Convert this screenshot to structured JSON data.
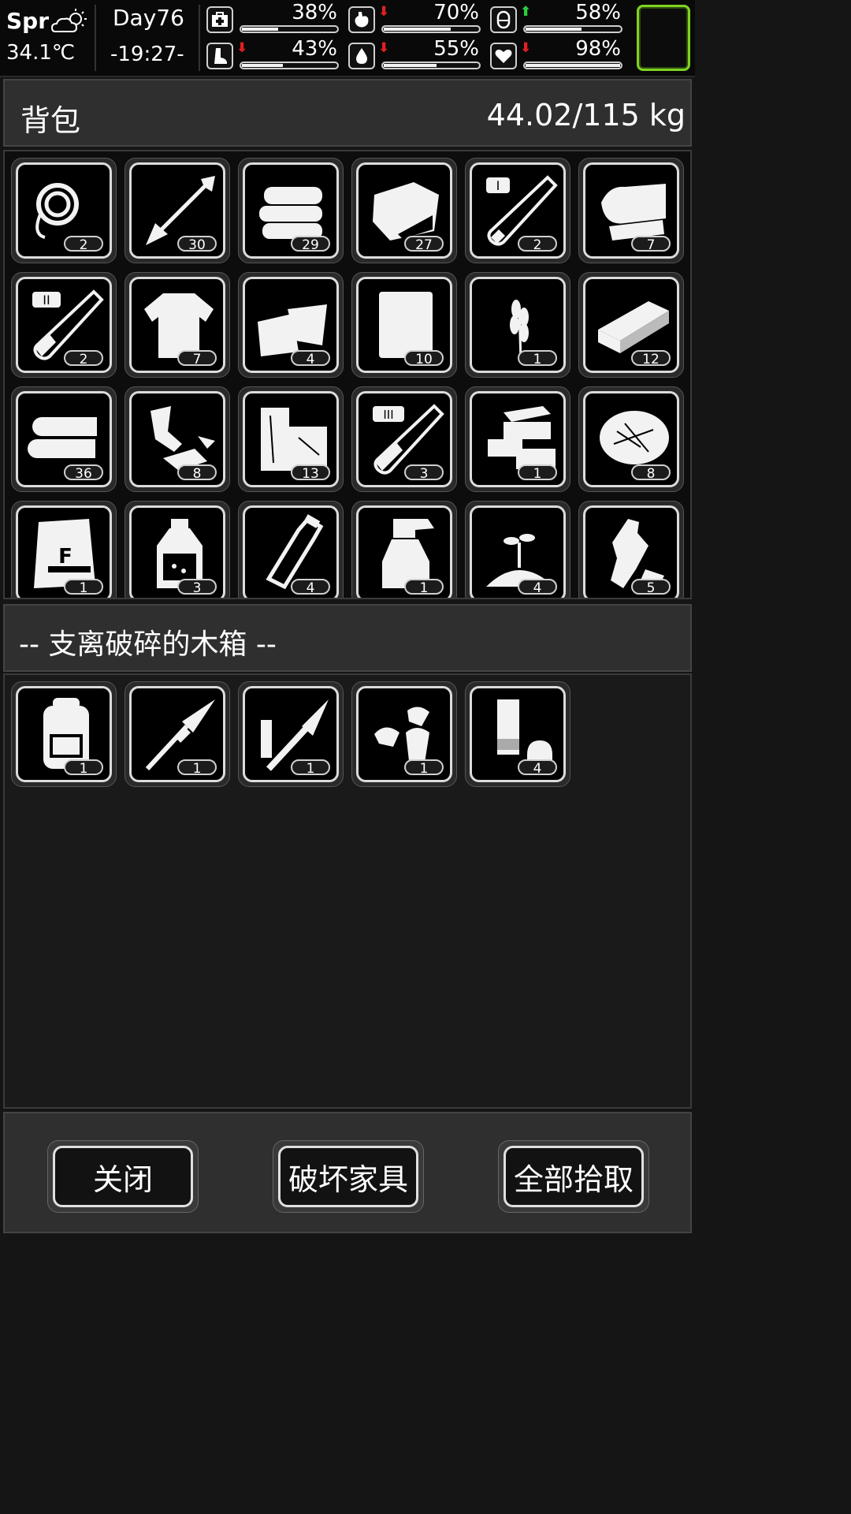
{
  "hud": {
    "season": "Spr",
    "temperature": "34.1℃",
    "day": "Day76",
    "time": "-19:27-",
    "preview_accent": "#7ed321",
    "stats": [
      {
        "icon": "medkit-icon",
        "value": "38%",
        "fraction": 0.38,
        "trend": "none"
      },
      {
        "icon": "stomach-icon",
        "value": "70%",
        "fraction": 0.7,
        "trend": "down"
      },
      {
        "icon": "energy-capsule-icon",
        "value": "58%",
        "fraction": 0.58,
        "trend": "up"
      },
      {
        "icon": "foot-icon",
        "value": "43%",
        "fraction": 0.43,
        "trend": "down"
      },
      {
        "icon": "water-drop-icon",
        "value": "55%",
        "fraction": 0.55,
        "trend": "down"
      },
      {
        "icon": "heart-icon",
        "value": "98%",
        "fraction": 0.98,
        "trend": "down"
      }
    ],
    "trend_colors": {
      "up": "#2ecc40",
      "down": "#e02020"
    }
  },
  "backpack": {
    "title": "背包",
    "weight": "44.02/115 kg",
    "items": [
      {
        "icon": "rope-icon",
        "qty": "2"
      },
      {
        "icon": "arrow-icon",
        "qty": "30"
      },
      {
        "icon": "cloth-stack-icon",
        "qty": "29"
      },
      {
        "icon": "raw-meat-icon",
        "qty": "27"
      },
      {
        "icon": "test-tube-1-icon",
        "qty": "2"
      },
      {
        "icon": "folded-cloth-icon",
        "qty": "7"
      },
      {
        "icon": "test-tube-2-icon",
        "qty": "2"
      },
      {
        "icon": "torn-shirt-icon",
        "qty": "7"
      },
      {
        "icon": "cloth-scraps-icon",
        "qty": "4"
      },
      {
        "icon": "paper-sheet-icon",
        "qty": "10"
      },
      {
        "icon": "wheat-icon",
        "qty": "1"
      },
      {
        "icon": "wood-plank-icon",
        "qty": "12"
      },
      {
        "icon": "logs-icon",
        "qty": "36"
      },
      {
        "icon": "leather-scraps-icon",
        "qty": "8"
      },
      {
        "icon": "wood-blocks-icon",
        "qty": "13"
      },
      {
        "icon": "test-tube-3-icon",
        "qty": "3"
      },
      {
        "icon": "bricks-icon",
        "qty": "1"
      },
      {
        "icon": "fiber-bundle-icon",
        "qty": "8"
      },
      {
        "icon": "fertilizer-bag-icon",
        "qty": "1"
      },
      {
        "icon": "bottle-icon",
        "qty": "3"
      },
      {
        "icon": "glass-bottle-icon",
        "qty": "4"
      },
      {
        "icon": "spray-bottle-icon",
        "qty": "1"
      },
      {
        "icon": "seedling-soil-icon",
        "qty": "4"
      },
      {
        "icon": "crushed-bottle-icon",
        "qty": "5"
      }
    ]
  },
  "container": {
    "title": "-- 支离破碎的木箱 --",
    "items": [
      {
        "icon": "backpack-icon",
        "qty": "1"
      },
      {
        "icon": "rocket-warhead-icon",
        "qty": "1"
      },
      {
        "icon": "rpg-launcher-icon",
        "qty": "1"
      },
      {
        "icon": "bullets-icon",
        "qty": "1"
      },
      {
        "icon": "battery-cells-icon",
        "qty": "4"
      }
    ]
  },
  "buttons": {
    "close": "关闭",
    "destroy": "破坏家具",
    "pickup_all": "全部拾取"
  }
}
